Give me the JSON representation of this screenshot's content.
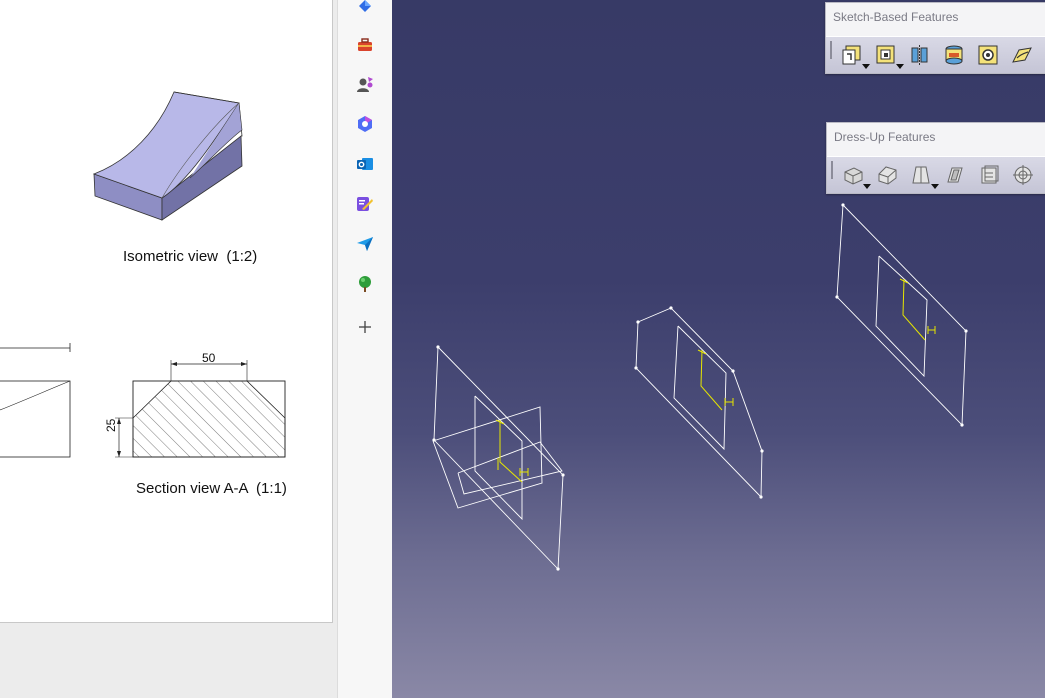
{
  "drawing": {
    "isometric_caption": "Isometric view  (1:2)",
    "section_caption": "Section view A-A  (1:1)",
    "dimension_width": "50",
    "dimension_height": "25"
  },
  "sidebar": {
    "items": [
      {
        "name": "copilot-icon"
      },
      {
        "name": "toolbox-icon"
      },
      {
        "name": "people-icon"
      },
      {
        "name": "m365-icon"
      },
      {
        "name": "outlook-icon"
      },
      {
        "name": "designer-icon"
      },
      {
        "name": "send-icon"
      },
      {
        "name": "tree-icon"
      },
      {
        "name": "add-icon"
      }
    ]
  },
  "toolbars": {
    "sketch_based": {
      "title": "Sketch-Based Features",
      "tools": [
        "pad-icon",
        "pocket-icon",
        "shaft-icon",
        "groove-icon",
        "hole-icon",
        "rib-icon"
      ]
    },
    "dress_up": {
      "title": "Dress-Up Features",
      "tools": [
        "edge-fillet-icon",
        "chamfer-icon",
        "draft-icon",
        "shell-icon",
        "thickness-icon",
        "thread-icon"
      ]
    }
  },
  "colors": {
    "viewport_top": "#373a66",
    "viewport_bottom": "#8a88a6",
    "sketch_line": "#ffffff",
    "sketch_axis": "#e6e600",
    "part_face": "#b8b8e8"
  }
}
